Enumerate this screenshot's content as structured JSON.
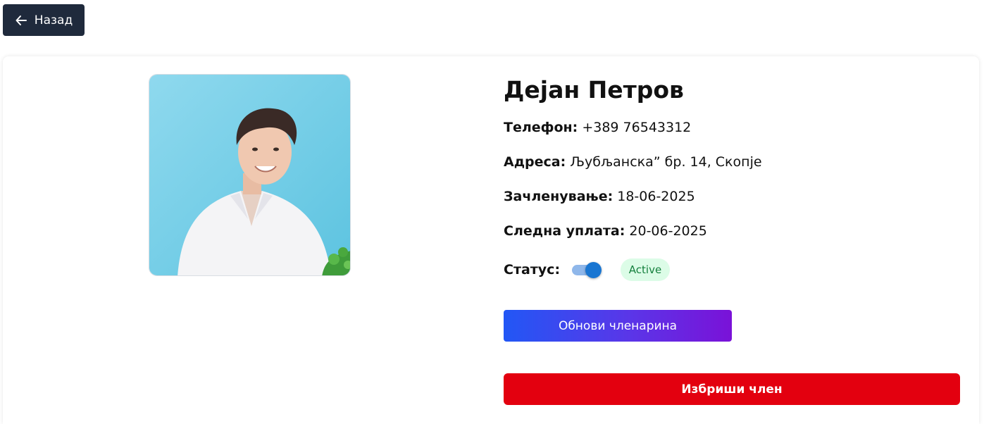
{
  "nav": {
    "back_label": "Назад",
    "back_icon": "arrow-left-icon"
  },
  "member": {
    "name": "Дејан Петров",
    "photo_icon": "member-photo",
    "phone_label": "Телефон:",
    "phone": "+389 76543312",
    "address_label": "Адреса:",
    "address": "Љубљанска” бр. 14, Скопје",
    "joined_label": "Зачленување:",
    "joined": "18-06-2025",
    "next_payment_label": "Следна уплата:",
    "next_payment": "20-06-2025",
    "status_label": "Статус:",
    "status_on": true,
    "status_badge": "Active"
  },
  "actions": {
    "renew_label": "Обнови членарина",
    "delete_label": "Избриши член"
  },
  "colors": {
    "back_button": "#1f2a3c",
    "toggle_on": "#1976d2",
    "badge_bg": "#dcfce7",
    "badge_text": "#15803d",
    "renew_gradient_start": "#2257f5",
    "renew_gradient_end": "#7a12d8",
    "delete_button": "#e3000f"
  }
}
